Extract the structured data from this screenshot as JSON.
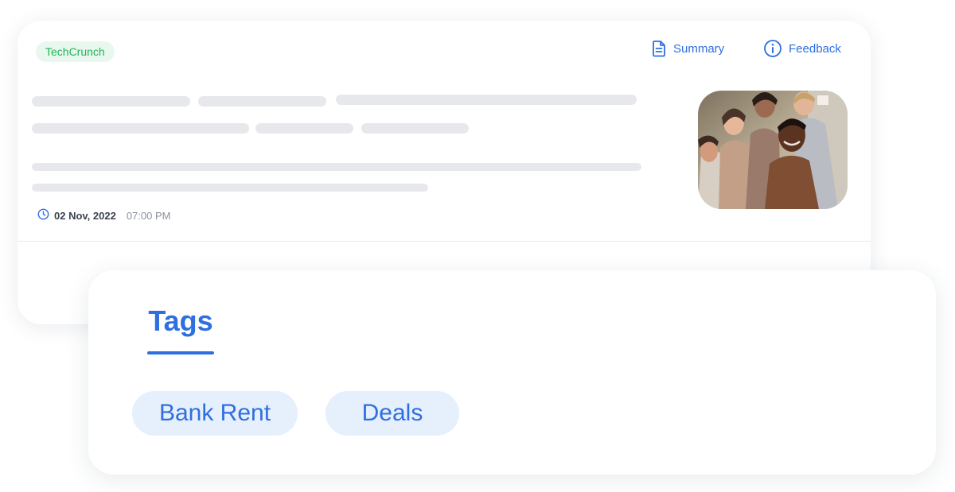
{
  "article": {
    "source": "TechCrunch",
    "actions": {
      "summary_label": "Summary",
      "summary_icon": "document-icon",
      "feedback_label": "Feedback",
      "feedback_icon": "info-icon"
    },
    "date": "02 Nov, 2022",
    "time": "07:00 PM",
    "clock_icon": "clock-icon"
  },
  "tags_panel": {
    "tab_label": "Tags",
    "tags": [
      "Bank Rent",
      "Deals"
    ]
  },
  "colors": {
    "accent": "#2f6fe0",
    "source_green": "#21b35a",
    "skeleton": "#e6e8ec",
    "chip_background": "#e6effc"
  }
}
